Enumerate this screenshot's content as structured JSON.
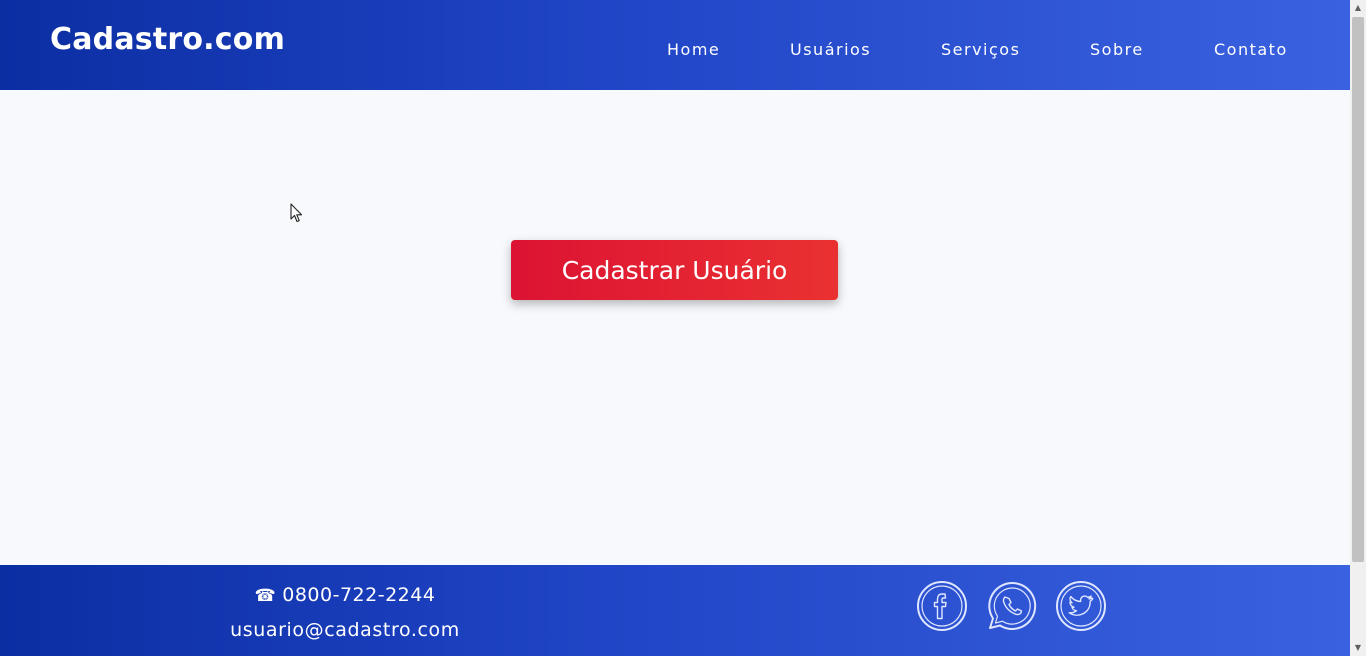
{
  "header": {
    "brand": "Cadastro.com",
    "nav": [
      {
        "label": "Home"
      },
      {
        "label": "Usuários"
      },
      {
        "label": "Serviços"
      },
      {
        "label": "Sobre"
      },
      {
        "label": "Contato"
      }
    ]
  },
  "main": {
    "cta_label": "Cadastrar Usuário"
  },
  "footer": {
    "phone": "0800-722-2244",
    "email": "usuario@cadastro.com",
    "social_icons": [
      "facebook-icon",
      "whatsapp-icon",
      "twitter-icon"
    ]
  },
  "colors": {
    "header_gradient_start": "#0c2ea3",
    "header_gradient_end": "#3a62e0",
    "cta_red": "#e01f36",
    "page_background": "#f8f9fd"
  }
}
